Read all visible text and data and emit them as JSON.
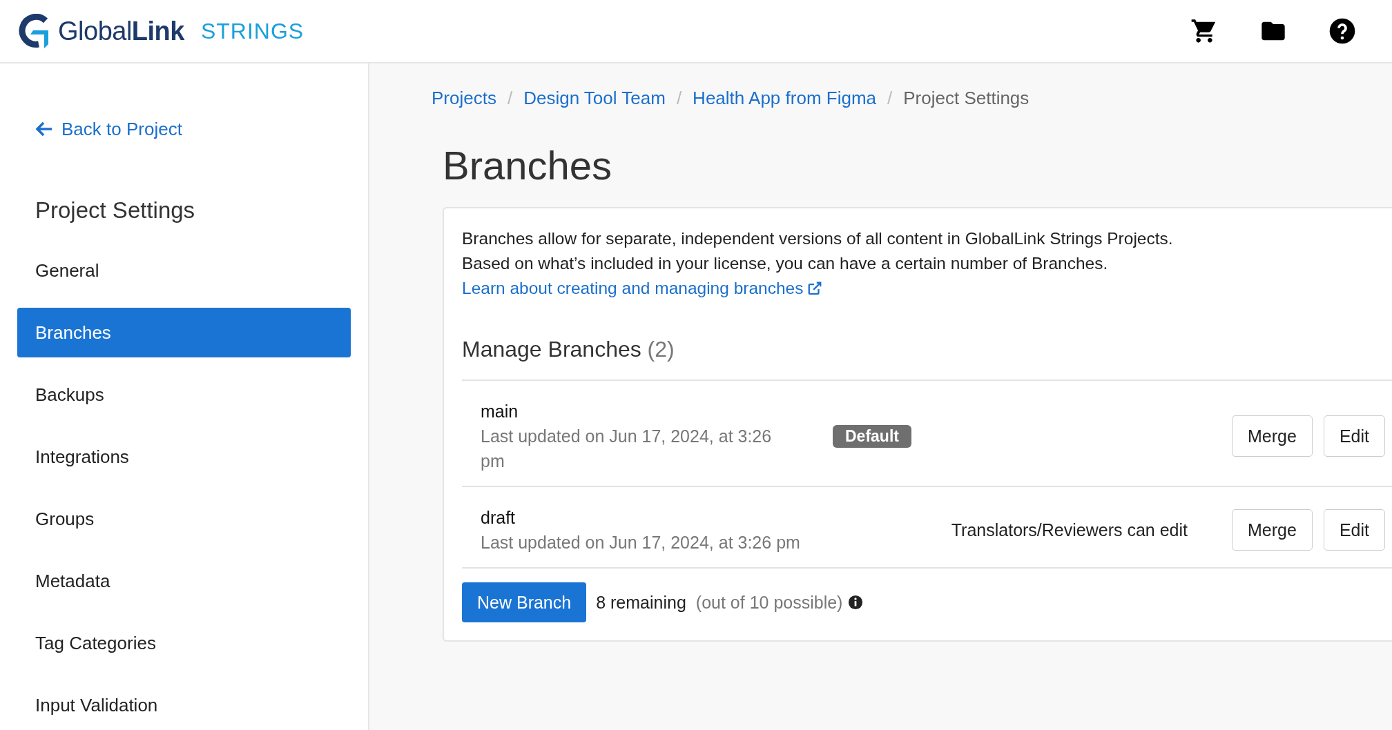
{
  "header": {
    "logo": {
      "brand": "Global",
      "brand_bold": "Link",
      "product": "STRINGS"
    }
  },
  "sidebar": {
    "back_link": "Back to Project",
    "heading": "Project Settings",
    "items": [
      {
        "label": "General",
        "selected": false
      },
      {
        "label": "Branches",
        "selected": true
      },
      {
        "label": "Backups",
        "selected": false
      },
      {
        "label": "Integrations",
        "selected": false
      },
      {
        "label": "Groups",
        "selected": false
      },
      {
        "label": "Metadata",
        "selected": false
      },
      {
        "label": "Tag Categories",
        "selected": false
      },
      {
        "label": "Input Validation",
        "selected": false
      }
    ]
  },
  "breadcrumb_separator": "/",
  "breadcrumb": [
    {
      "label": "Projects",
      "selected": false
    },
    {
      "label": "Design Tool Team",
      "selected": false
    },
    {
      "label": "Health App from Figma",
      "selected": false
    },
    {
      "label": "Project Settings",
      "selected": true
    }
  ],
  "page_title": "Branches",
  "intro": {
    "lines": [
      "Branches allow for separate, independent versions of all content in GlobalLink Strings Projects.",
      "Based on what’s included in your license, you can have a certain number of Branches."
    ],
    "link": "Learn about creating and managing branches"
  },
  "manage": {
    "title": "Manage Branches",
    "count": "(2)"
  },
  "branches": [
    {
      "name": "main",
      "updated": "Last updated on Jun 17, 2024, at 3:26 pm",
      "badge": "Default",
      "buttons": [
        "Merge",
        "Edit"
      ]
    },
    {
      "name": "draft",
      "updated": "Last updated on Jun 17, 2024, at 3:26 pm",
      "permission": "Translators/Reviewers can edit",
      "buttons": [
        "Merge",
        "Edit"
      ]
    }
  ],
  "footer": {
    "button": "New Branch",
    "remaining": "8 remaining",
    "possible": "(out of 10 possible)"
  }
}
